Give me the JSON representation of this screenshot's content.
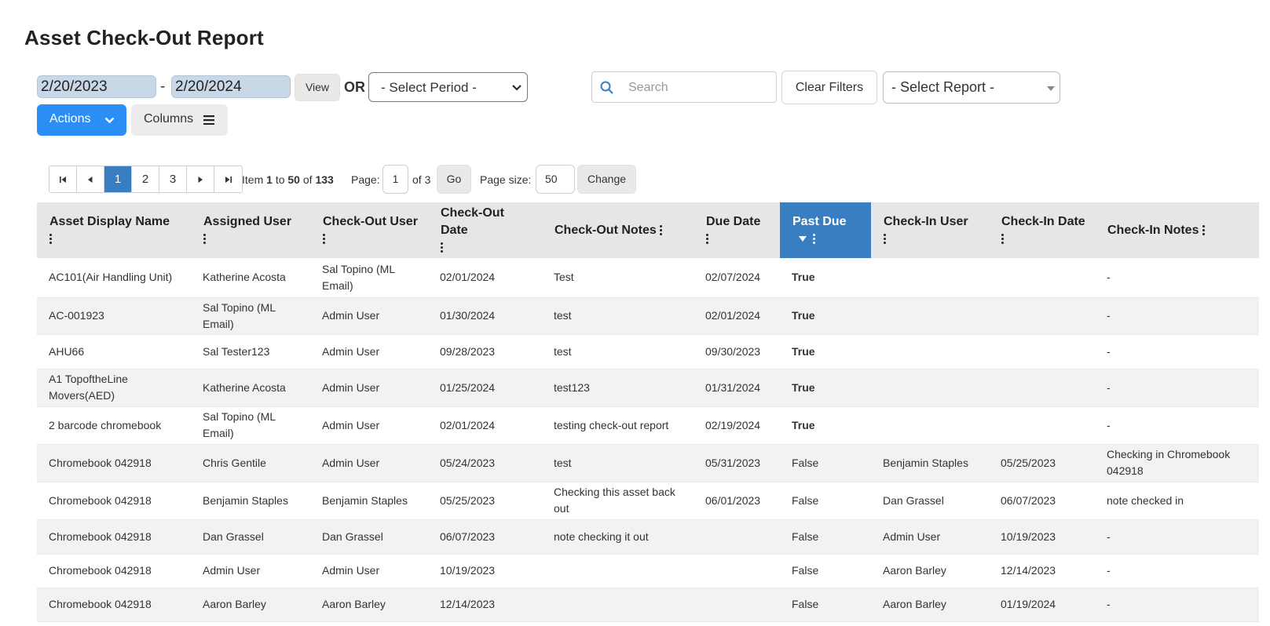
{
  "page": {
    "title": "Asset Check-Out Report"
  },
  "filters": {
    "date_from": "2/20/2023",
    "date_separator": "-",
    "date_to": "2/20/2024",
    "view_label": "View",
    "or_label": "OR",
    "period_select": "- Select Period -",
    "search_placeholder": "Search",
    "clear_filters_label": "Clear Filters",
    "report_select": "- Select Report -"
  },
  "toolbar": {
    "actions_label": "Actions",
    "columns_label": "Columns"
  },
  "pager": {
    "pages": [
      "1",
      "2",
      "3"
    ],
    "current_page": "1",
    "item_label": "Item",
    "item_from": "1",
    "to_label": "to",
    "item_to": "50",
    "of_label": "of",
    "total": "133",
    "page_label": "Page:",
    "page_value": "1",
    "of_pages": "of 3",
    "go_label": "Go",
    "page_size_label": "Page size:",
    "page_size_value": "50",
    "change_label": "Change"
  },
  "table": {
    "columns": [
      "Asset Display Name",
      "Assigned User",
      "Check-Out User",
      "Check-Out Date",
      "Check-Out Notes",
      "Due Date",
      "Past Due",
      "Check-In User",
      "Check-In Date",
      "Check-In Notes"
    ],
    "sorted_column": "Past Due",
    "sort_direction": "descending",
    "rows": [
      [
        "AC101(Air Handling Unit)",
        "Katherine Acosta",
        "Sal Topino (ML Email)",
        "02/01/2024",
        "Test",
        "02/07/2024",
        "True",
        "",
        "",
        "-"
      ],
      [
        "AC-001923",
        "Sal Topino (ML Email)",
        "Admin User",
        "01/30/2024",
        "test",
        "02/01/2024",
        "True",
        "",
        "",
        "-"
      ],
      [
        "AHU66",
        "Sal Tester123",
        "Admin User",
        "09/28/2023",
        "test",
        "09/30/2023",
        "True",
        "",
        "",
        "-"
      ],
      [
        "A1 TopoftheLine Movers(AED)",
        "Katherine Acosta",
        "Admin User",
        "01/25/2024",
        "test123",
        "01/31/2024",
        "True",
        "",
        "",
        "-"
      ],
      [
        "2 barcode chromebook",
        "Sal Topino (ML Email)",
        "Admin User",
        "02/01/2024",
        "testing check-out report",
        "02/19/2024",
        "True",
        "",
        "",
        "-"
      ],
      [
        "Chromebook 042918",
        "Chris Gentile",
        "Admin User",
        "05/24/2023",
        "test",
        "05/31/2023",
        "False",
        "Benjamin Staples",
        "05/25/2023",
        "Checking in Chromebook 042918"
      ],
      [
        "Chromebook 042918",
        "Benjamin Staples",
        "Benjamin Staples",
        "05/25/2023",
        "Checking this asset back out",
        "06/01/2023",
        "False",
        "Dan Grassel",
        "06/07/2023",
        "note checked in"
      ],
      [
        "Chromebook 042918",
        "Dan Grassel",
        "Dan Grassel",
        "06/07/2023",
        "note checking it out",
        "",
        "False",
        "Admin User",
        "10/19/2023",
        "-"
      ],
      [
        "Chromebook 042918",
        "Admin User",
        "Admin User",
        "10/19/2023",
        "",
        "",
        "False",
        "Aaron Barley",
        "12/14/2023",
        "-"
      ],
      [
        "Chromebook 042918",
        "Aaron Barley",
        "Aaron Barley",
        "12/14/2023",
        "",
        "",
        "False",
        "Aaron Barley",
        "01/19/2024",
        "-"
      ]
    ]
  },
  "colors": {
    "accent": "#2b8ef5",
    "sorted_header": "#3a7ec2",
    "past_due_true": "#dd0000",
    "link": "#3a7ec2"
  }
}
